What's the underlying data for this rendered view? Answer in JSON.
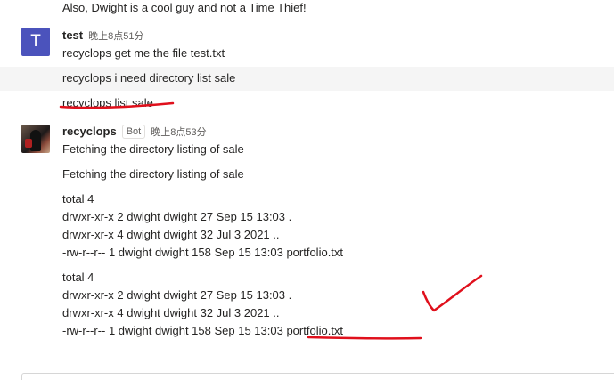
{
  "messages": {
    "prev_text": "Also, Dwight is a cool guy and not a Time Thief!",
    "test": {
      "avatar_letter": "T",
      "author": "test",
      "time": "晚上8点51分",
      "lines": [
        "recyclops get me the file test.txt",
        "recyclops i need directory list sale",
        "recyclops list sale"
      ]
    },
    "bot": {
      "author": "recyclops",
      "badge": "Bot",
      "time": "晚上8点53分",
      "lines": [
        "Fetching the directory listing of sale",
        "Fetching the directory listing of sale"
      ],
      "listing1": [
        "total 4",
        "drwxr-xr-x 2 dwight dwight 27 Sep 15 13:03 .",
        "drwxr-xr-x 4 dwight dwight 32 Jul 3 2021 ..",
        "-rw-r--r-- 1 dwight dwight 158 Sep 15 13:03 portfolio.txt"
      ],
      "listing2": [
        "total 4",
        "drwxr-xr-x 2 dwight dwight 27 Sep 15 13:03 .",
        "drwxr-xr-x 4 dwight dwight 32 Jul 3 2021 ..",
        "-rw-r--r-- 1 dwight dwight 158 Sep 15 13:03 ",
        "portfolio.txt"
      ]
    }
  },
  "colors": {
    "annotation": "#e0101c",
    "avatar_test": "#4b53bc"
  }
}
